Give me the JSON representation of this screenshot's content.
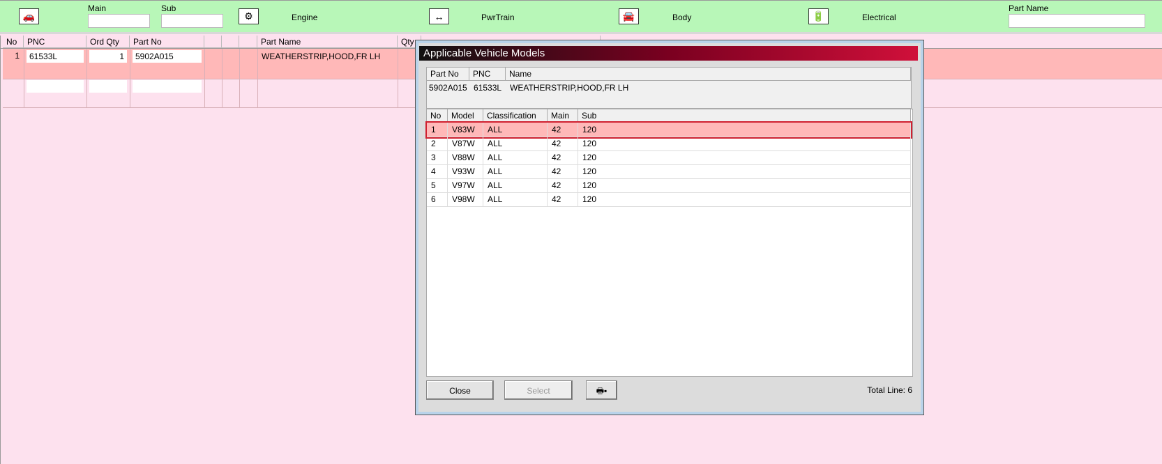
{
  "topbar": {
    "main_label": "Main",
    "sub_label": "Sub",
    "engine": "Engine",
    "pwrtrain": "PwrTrain",
    "body": "Body",
    "electrical": "Electrical",
    "part_name_label": "Part Name",
    "main_value": "",
    "sub_value": "",
    "part_name_value": ""
  },
  "grid": {
    "headers": [
      "No",
      "PNC",
      "Ord Qty",
      "Part No",
      "",
      "",
      "",
      "Part Name",
      "Qty"
    ],
    "rows": [
      {
        "no": "1",
        "pnc": "61533L",
        "ord_qty": "1",
        "part_no": "5902A015",
        "part_name": "WEATHERSTRIP,HOOD,FR LH"
      }
    ]
  },
  "dialog": {
    "title": "Applicable Vehicle Models",
    "info_headers": [
      "Part No",
      "PNC",
      "Name"
    ],
    "info": {
      "part_no": "5902A015",
      "pnc": "61533L",
      "name": "WEATHERSTRIP,HOOD,FR LH"
    },
    "list_headers": [
      "No",
      "Model",
      "Classification",
      "Main",
      "Sub"
    ],
    "rows": [
      [
        "1",
        "V83W",
        "ALL",
        "42",
        "120"
      ],
      [
        "2",
        "V87W",
        "ALL",
        "42",
        "120"
      ],
      [
        "3",
        "V88W",
        "ALL",
        "42",
        "120"
      ],
      [
        "4",
        "V93W",
        "ALL",
        "42",
        "120"
      ],
      [
        "5",
        "V97W",
        "ALL",
        "42",
        "120"
      ],
      [
        "6",
        "V98W",
        "ALL",
        "42",
        "120"
      ]
    ],
    "close": "Close",
    "select": "Select",
    "total": "Total Line: 6"
  },
  "colors": {
    "topbar": "#b8f7b8",
    "selected_row": "#ffb8b8",
    "background": "#fde1ee"
  }
}
